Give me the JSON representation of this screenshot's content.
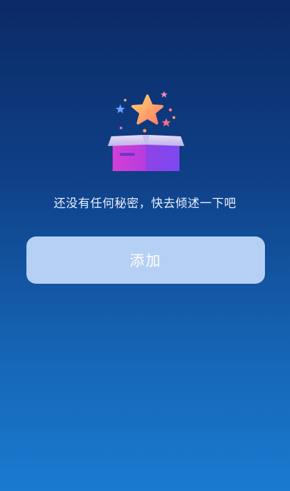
{
  "empty_state": {
    "message": "还没有任何秘密，快去倾述一下吧",
    "illustration_icon": "gift-box-with-star-icon"
  },
  "actions": {
    "add_label": "添加"
  },
  "colors": {
    "background_top": "#0b2a66",
    "background_bottom": "#1a7ad0",
    "button_bg": "#b6d0f5",
    "button_text": "#ffffff",
    "message_text": "#e9f1ff"
  }
}
